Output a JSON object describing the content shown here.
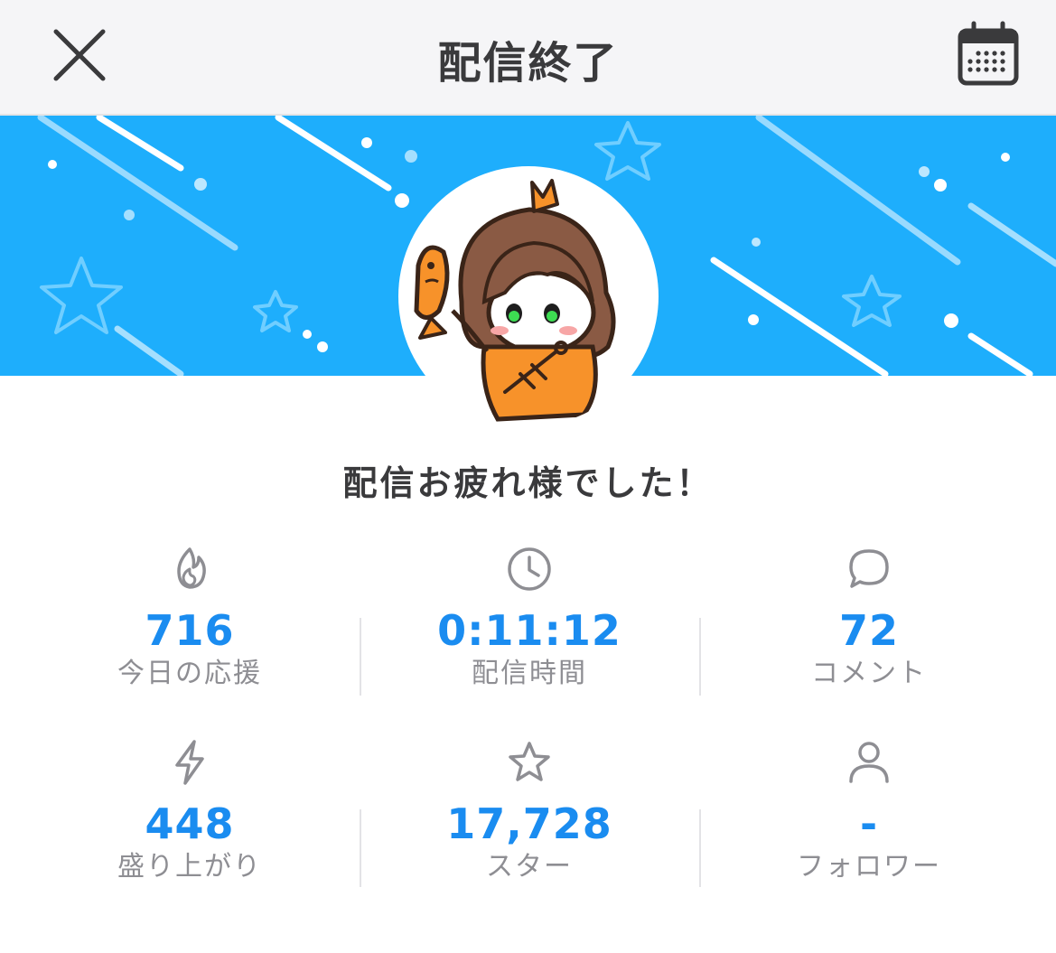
{
  "header": {
    "title": "配信終了",
    "close_icon": "close-icon",
    "calendar_icon": "calendar-icon"
  },
  "colors": {
    "accent": "#1a8cf0",
    "banner": "#1eaefc",
    "avatar_shirt": "#f7922a"
  },
  "greeting": "配信お疲れ様でした！",
  "stats": [
    {
      "icon": "flame-icon",
      "value": "716",
      "label": "今日の応援"
    },
    {
      "icon": "clock-icon",
      "value": "0:11:12",
      "label": "配信時間"
    },
    {
      "icon": "comment-icon",
      "value": "72",
      "label": "コメント"
    },
    {
      "icon": "lightning-icon",
      "value": "448",
      "label": "盛り上がり"
    },
    {
      "icon": "star-icon",
      "value": "17,728",
      "label": "スター"
    },
    {
      "icon": "person-icon",
      "value": "-",
      "label": "フォロワー"
    }
  ]
}
